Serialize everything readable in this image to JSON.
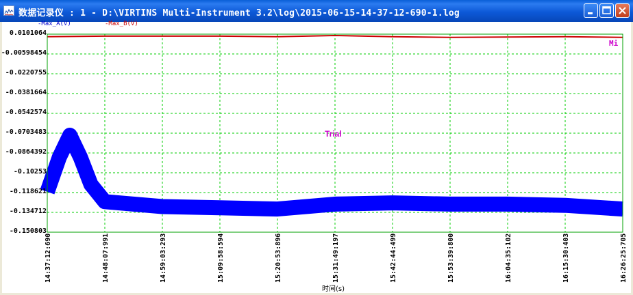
{
  "window": {
    "title": "数据记录仪 : 1 - D:\\VIRTINS Multi-Instrument 3.2\\log\\2015-06-15-14-37-12-690-1.log",
    "icon": "chart-window-icon",
    "buttons": [
      "minimize-icon",
      "maximize-icon",
      "close-icon"
    ]
  },
  "legend": {
    "series_a": "-Max_A(V)",
    "series_b": "-Max_B(V)"
  },
  "annotations": {
    "marker": "Mi",
    "watermark": "Trial"
  },
  "colors": {
    "series_a": "#0000FF",
    "series_b": "#CC0000",
    "grid": "#00CC00",
    "plot_border": "#00A000",
    "annotation": "#CC00CC"
  },
  "chart_data": {
    "type": "line",
    "xlabel": "时间(s)",
    "ylabel": "",
    "x_ticks": [
      "14:37:12:690",
      "14:48:07:991",
      "14:59:03:293",
      "15:09:58:594",
      "15:20:53:896",
      "15:31:49:197",
      "15:42:44:499",
      "15:53:39:800",
      "16:04:35:102",
      "16:15:30:403",
      "16:26:25:705"
    ],
    "y_ticks": [
      "0.0101064",
      "-0.00598454",
      "-0.0220755",
      "-0.0381664",
      "-0.0542574",
      "-0.0703483",
      "-0.0864392",
      "-0.10253",
      "-0.118621",
      "-0.134712",
      "-0.150803"
    ],
    "ylim": [
      -0.150803,
      0.0101064
    ],
    "grid": true,
    "series": [
      {
        "name": "-Max_B(V)",
        "x": [
          "14:37:12:690",
          "14:48:07:991",
          "14:59:03:293",
          "15:09:58:594",
          "15:20:53:896",
          "15:31:49:197",
          "15:42:44:499",
          "15:53:39:800",
          "16:04:35:102",
          "16:15:30:403",
          "16:26:25:705"
        ],
        "values": [
          0.008,
          0.0085,
          0.0085,
          0.0085,
          0.008,
          0.009,
          0.008,
          0.0075,
          0.0078,
          0.008,
          0.0075
        ]
      },
      {
        "name": "-Max_A(V)",
        "x": [
          "14:37:12:690",
          "14:39:30",
          "14:41:30",
          "14:43:30",
          "14:45:30",
          "14:48:07:991",
          "14:59:03:293",
          "15:09:58:594",
          "15:20:53:896",
          "15:31:49:197",
          "15:42:44:499",
          "15:53:39:800",
          "16:04:35:102",
          "16:15:30:403",
          "16:26:25:705"
        ],
        "values": [
          -0.118,
          -0.09,
          -0.072,
          -0.09,
          -0.112,
          -0.126,
          -0.13,
          -0.131,
          -0.132,
          -0.128,
          -0.127,
          -0.128,
          -0.128,
          -0.129,
          -0.132
        ]
      }
    ]
  }
}
